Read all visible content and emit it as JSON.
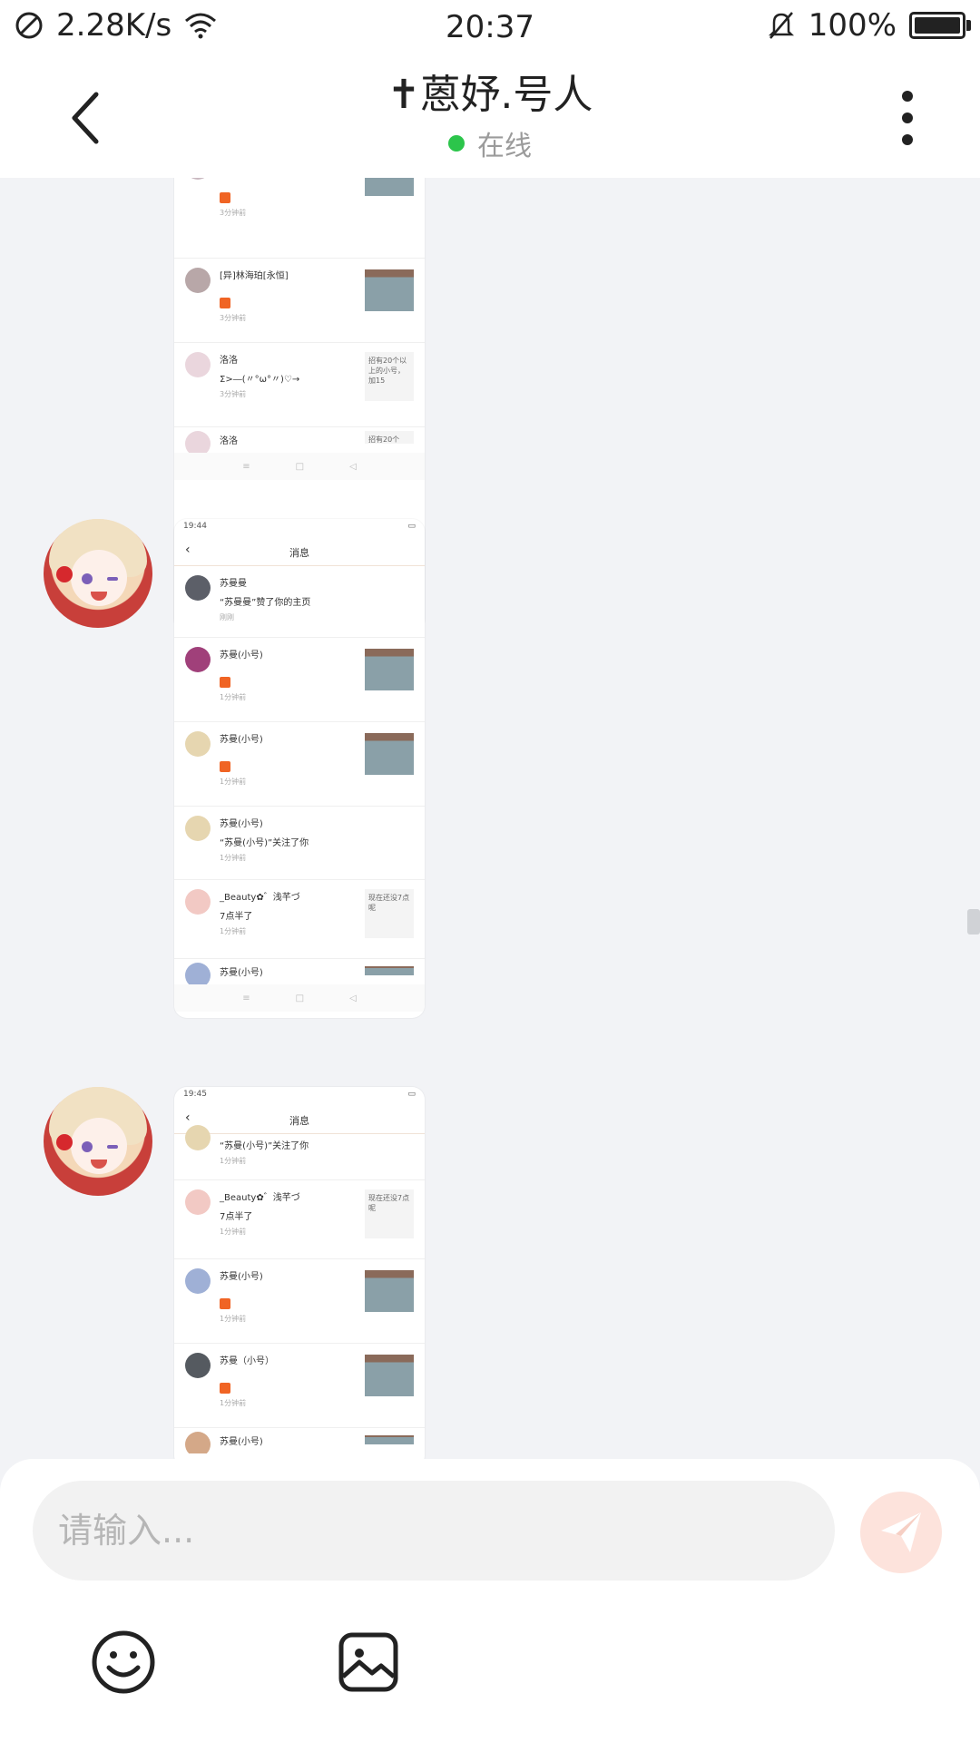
{
  "status_bar": {
    "net_speed": "2.28K/s",
    "time": "20:37",
    "battery_percent": "100%"
  },
  "header": {
    "title": "✝蒽妤.号人",
    "status_text": "在线"
  },
  "messages": [
    {
      "kind": "screenshot",
      "rows": [
        {
          "name": "",
          "text": "",
          "meta": "3分钟前",
          "attachment": "thumb"
        },
        {
          "name": "[异]林海珀[永恒]",
          "text": "",
          "meta": "3分钟前",
          "attachment": "thumb"
        },
        {
          "name": "洛洛",
          "text": "Σ>―(〃°ω°〃)♡→",
          "meta": "3分钟前",
          "attachment": "note",
          "note": "招有20个以上的小号，加15"
        },
        {
          "name": "洛洛",
          "text": "",
          "meta": "",
          "attachment": "note",
          "note": "招有20个"
        }
      ]
    },
    {
      "kind": "screenshot",
      "shot_time": "19:44",
      "shot_title": "消息",
      "rows": [
        {
          "name": "苏曼曼",
          "text": "“苏曼曼”赞了你的主页",
          "meta": "刚刚",
          "attachment": ""
        },
        {
          "name": "苏曼(小号)",
          "text": "",
          "meta": "1分钟前",
          "attachment": "thumb"
        },
        {
          "name": "苏曼(小号)",
          "text": "",
          "meta": "1分钟前",
          "attachment": "thumb"
        },
        {
          "name": "苏曼(小号)",
          "text": "“苏曼(小号)”关注了你",
          "meta": "1分钟前",
          "attachment": ""
        },
        {
          "name": "_Beauty✿゛浅芊づ",
          "text": "7点半了",
          "meta": "1分钟前",
          "attachment": "note",
          "note": "现在还没7点呢"
        },
        {
          "name": "苏曼(小号)",
          "text": "",
          "meta": "",
          "attachment": "thumb"
        }
      ]
    },
    {
      "kind": "screenshot",
      "shot_time": "19:45",
      "shot_title": "消息",
      "rows": [
        {
          "name": "苏曼(小号)",
          "text": "“苏曼(小号)”关注了你",
          "meta": "1分钟前",
          "attachment": ""
        },
        {
          "name": "_Beauty✿゛浅芊づ",
          "text": "7点半了",
          "meta": "1分钟前",
          "attachment": "note",
          "note": "现在还没7点呢"
        },
        {
          "name": "苏曼(小号)",
          "text": "",
          "meta": "1分钟前",
          "attachment": "thumb"
        },
        {
          "name": "苏曼（小号）",
          "text": "",
          "meta": "1分钟前",
          "attachment": "thumb"
        },
        {
          "name": "苏曼(小号)",
          "text": "",
          "meta": "",
          "attachment": "thumb"
        }
      ]
    }
  ],
  "composer": {
    "placeholder": "请输入..."
  },
  "colors": {
    "online_dot": "#2cc54b",
    "send_button": "#fde3dc",
    "like_icon": "#f06424"
  }
}
